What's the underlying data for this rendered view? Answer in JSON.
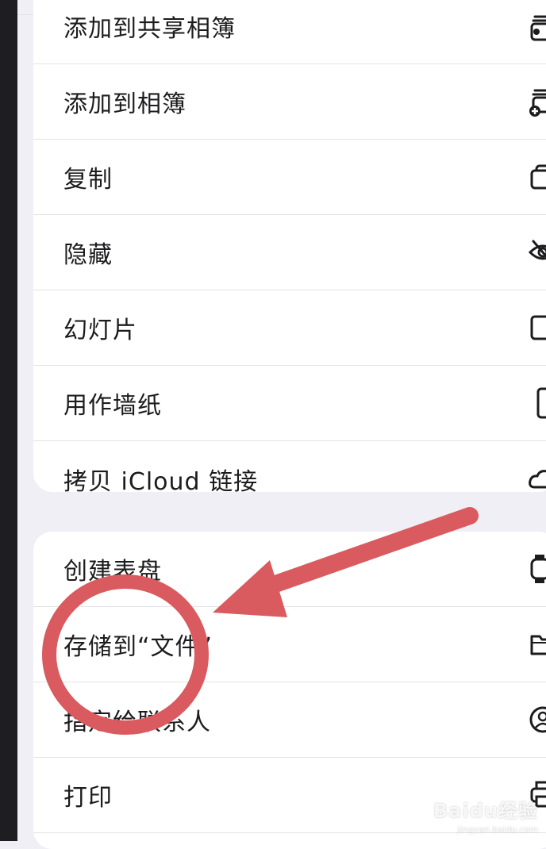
{
  "menu_group_1": {
    "items": [
      {
        "label": "添加到共享相簿",
        "icon": "shared-album-add-icon"
      },
      {
        "label": "添加到相簿",
        "icon": "album-add-icon"
      },
      {
        "label": "复制",
        "icon": "duplicate-icon"
      },
      {
        "label": "隐藏",
        "icon": "eye-slash-icon"
      },
      {
        "label": "幻灯片",
        "icon": "slideshow-icon"
      },
      {
        "label": "用作墙纸",
        "icon": "wallpaper-icon"
      },
      {
        "label": "拷贝 iCloud 链接",
        "icon": "cloud-link-icon"
      }
    ]
  },
  "menu_group_2": {
    "items": [
      {
        "label": "创建表盘",
        "icon": "watch-face-icon"
      },
      {
        "label": "存储到“文件”",
        "icon": "folder-icon"
      },
      {
        "label": "指定给联系人",
        "icon": "contact-icon"
      },
      {
        "label": "打印",
        "icon": "printer-icon"
      }
    ]
  },
  "annotation": {
    "color": "#d95a5f",
    "target": "存储到“文件”"
  },
  "watermark": {
    "main": "Baidu经验",
    "sub": "jingyan.baidu.com"
  }
}
